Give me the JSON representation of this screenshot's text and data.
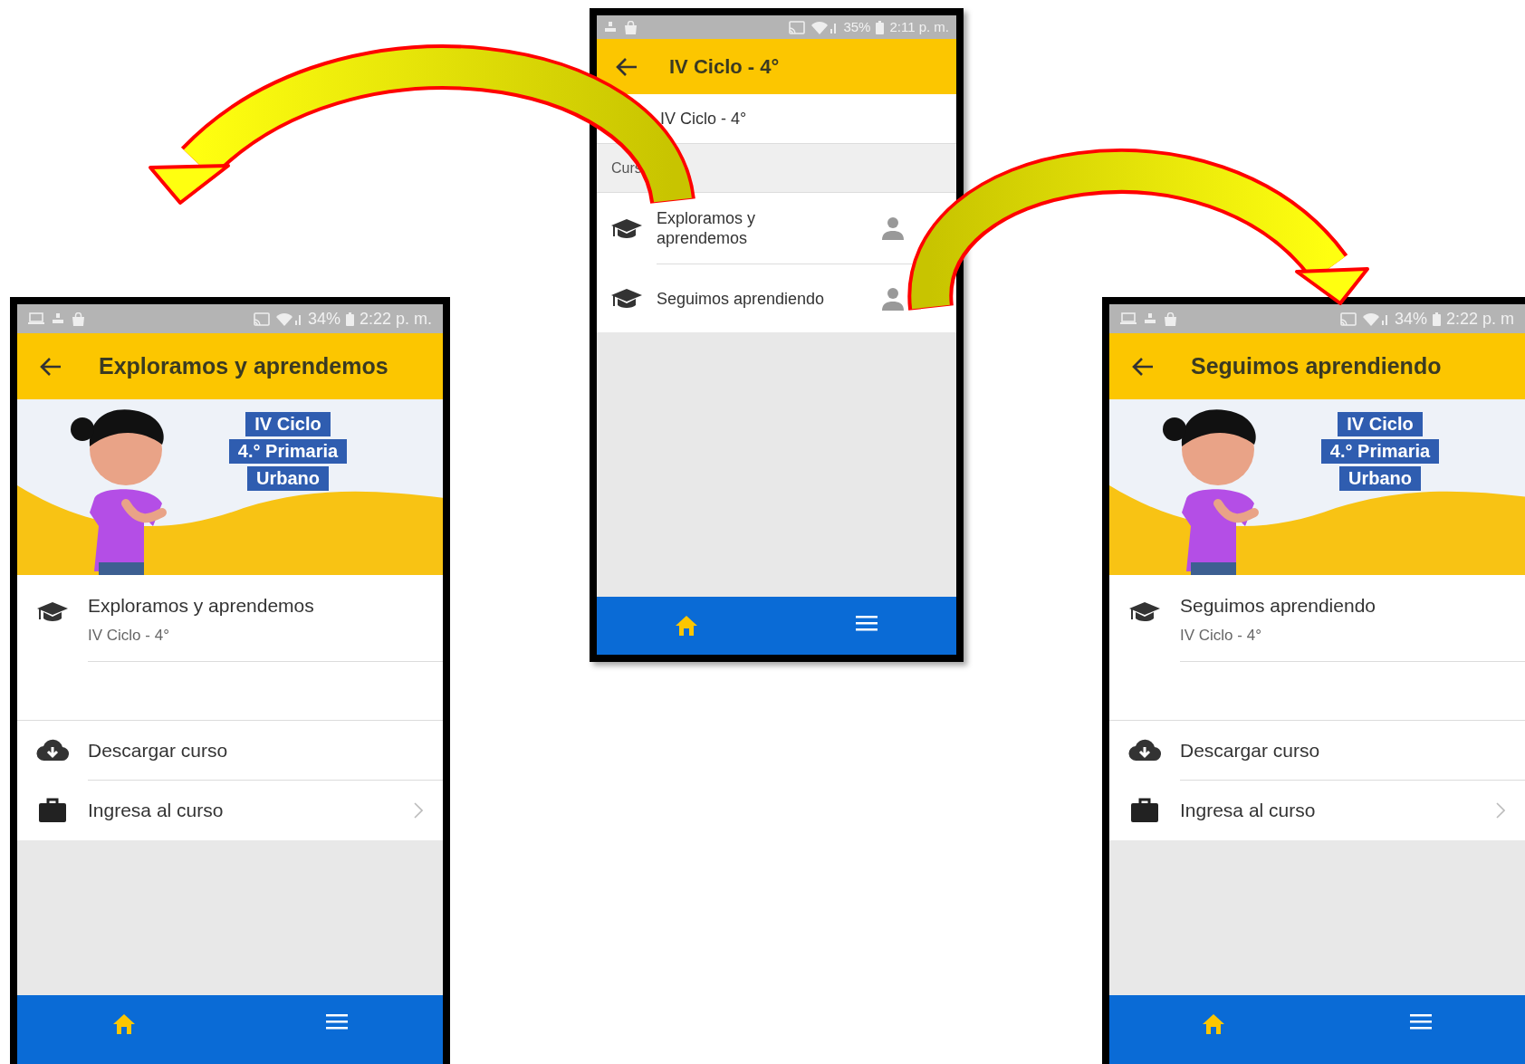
{
  "center_screen": {
    "status_bar": {
      "battery": "35%",
      "time": "2:11 p. m."
    },
    "app_bar": {
      "title": "IV Ciclo - 4°"
    },
    "subtitle": "IV Ciclo - 4°",
    "section_header": "Curs",
    "courses": [
      {
        "title": "Exploramos y aprendemos"
      },
      {
        "title": "Seguimos aprendiendo"
      }
    ],
    "nav": [
      {
        "kind": "home",
        "selected": true
      },
      {
        "kind": "menu",
        "selected": false
      }
    ]
  },
  "detail_screens": [
    {
      "status_bar": {
        "battery": "34%",
        "time": "2:22 p. m."
      },
      "title": "Exploramos y aprendemos",
      "banner_labels": [
        "IV Ciclo",
        "4.° Primaria",
        "Urbano"
      ],
      "course": {
        "title": "Exploramos y aprendemos",
        "subtitle": "IV Ciclo - 4°"
      },
      "actions": [
        {
          "kind": "download",
          "label": "Descargar curso"
        },
        {
          "kind": "enter",
          "label": "Ingresa al curso"
        }
      ],
      "nav": [
        {
          "kind": "home",
          "selected": true
        },
        {
          "kind": "menu",
          "selected": false
        }
      ]
    },
    {
      "status_bar": {
        "battery": "34%",
        "time": "2:22 p. m"
      },
      "title": "Seguimos aprendiendo",
      "banner_labels": [
        "IV Ciclo",
        "4.° Primaria",
        "Urbano"
      ],
      "course": {
        "title": "Seguimos aprendiendo",
        "subtitle": "IV Ciclo - 4°"
      },
      "actions": [
        {
          "kind": "download",
          "label": "Descargar curso"
        },
        {
          "kind": "enter",
          "label": "Ingresa al curso"
        }
      ],
      "nav": [
        {
          "kind": "home",
          "selected": true
        },
        {
          "kind": "menu",
          "selected": false
        }
      ]
    }
  ]
}
